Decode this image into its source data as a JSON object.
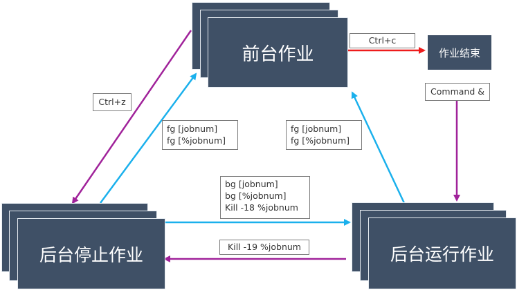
{
  "nodes": {
    "foreground": "前台作业",
    "stopped": "后台停止作业",
    "running": "后台运行作业",
    "finished": "作业结束"
  },
  "transitions": {
    "fg_to_end": "Ctrl+c",
    "fg_to_stopped": "Ctrl+z",
    "stopped_to_fg": [
      "fg  [jobnum]",
      "fg  [%jobnum]"
    ],
    "running_to_fg": [
      "fg  [jobnum]",
      "fg  [%jobnum]"
    ],
    "stopped_to_running": [
      "bg  [jobnum]",
      "bg  [%jobnum]",
      "Kill -18 %jobnum"
    ],
    "running_to_stopped": "Kill -19 %jobnum",
    "command_to_running": "Command &"
  },
  "colors": {
    "box_fill": "#3f5066",
    "suspend_arrow": "#a0229a",
    "resume_arrow": "#1ab0ec",
    "terminate_arrow": "#ee1c1c"
  }
}
